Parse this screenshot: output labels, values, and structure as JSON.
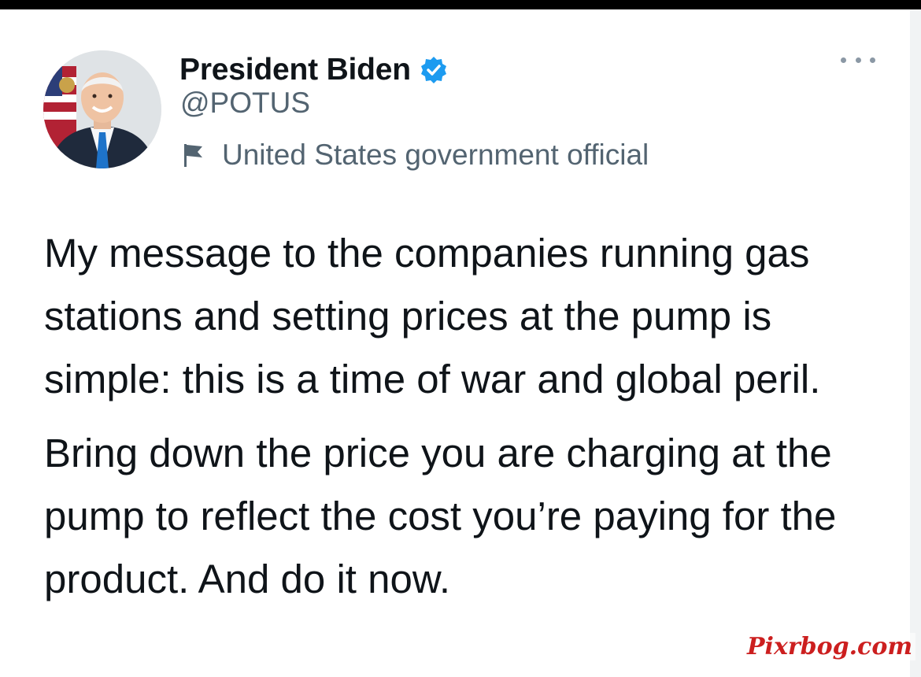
{
  "tweet": {
    "author": {
      "display_name": "President Biden",
      "handle": "@POTUS",
      "verified": true,
      "label": "United States government official"
    },
    "paragraphs": [
      "My message to the companies running gas stations and setting prices at the pump is simple: this is a time of war and global peril.",
      "Bring down the price you are charging at the pump to reflect the cost you’re paying for the product. And do it now."
    ]
  },
  "watermark": {
    "text": "Pixrbog.com"
  },
  "icons": {
    "verified": "verified-badge-icon",
    "label": "flag-icon",
    "more": "more-options-icon"
  },
  "colors": {
    "verified_blue": "#1d9bf0",
    "text_primary": "#0f1419",
    "text_secondary": "#536471",
    "watermark_red": "#cc1f1f"
  }
}
